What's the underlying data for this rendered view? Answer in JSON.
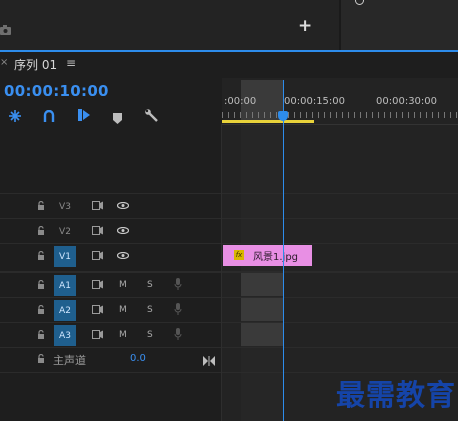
{
  "header": {
    "plus_label": "+",
    "close_mark": "×",
    "sequence_title": "序列 01",
    "menu_glyph": "≡",
    "timecode": "00:00:10:00"
  },
  "toolbar": {
    "icons": [
      "snap-icon",
      "linked-selection-icon",
      "add-marker-icon",
      "marker-icon",
      "wrench-icon"
    ]
  },
  "ruler": {
    "labels": [
      ":00:00",
      "00:00:15:00",
      "00:00:30:00"
    ],
    "playhead_color": "#2d8ceb",
    "work_area_color": "#e8d23a"
  },
  "tracks": {
    "video": [
      {
        "name": "V3",
        "highlight": false
      },
      {
        "name": "V2",
        "highlight": false
      },
      {
        "name": "V1",
        "highlight": true
      }
    ],
    "audio": [
      {
        "name": "A1",
        "m": "M",
        "s": "S"
      },
      {
        "name": "A2",
        "m": "M",
        "s": "S"
      },
      {
        "name": "A3",
        "m": "M",
        "s": "S"
      }
    ],
    "master": {
      "label": "主声道",
      "value": "0.0"
    }
  },
  "clip": {
    "fx": "fx",
    "name": "风景1.jpg",
    "color": "#e88fe4"
  },
  "watermark": "最需教育"
}
